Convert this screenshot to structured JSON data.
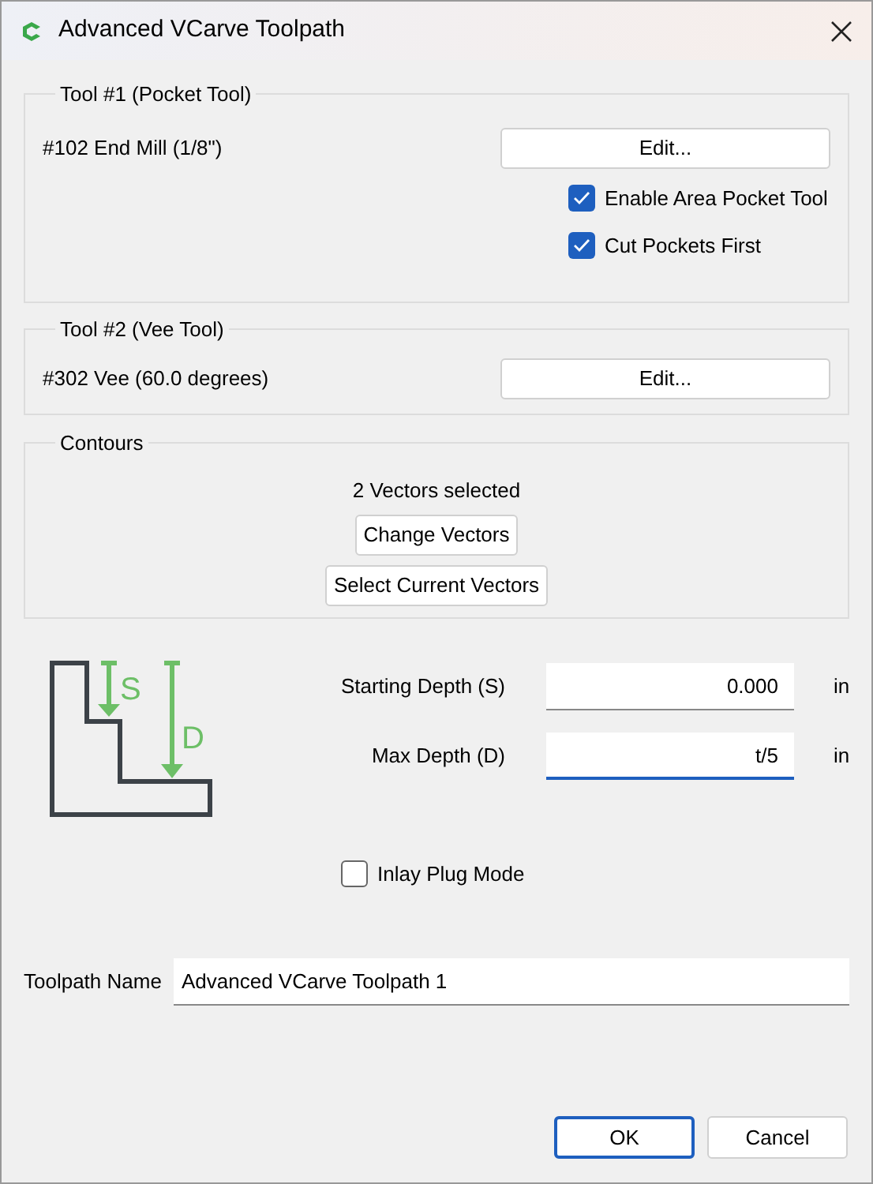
{
  "window": {
    "title": "Advanced VCarve Toolpath"
  },
  "tool1": {
    "title": "Tool #1 (Pocket Tool)",
    "tool_name": "#102 End Mill (1/8\")",
    "edit_button": "Edit...",
    "options": [
      {
        "label": "Enable Area Pocket Tool",
        "checked": true
      },
      {
        "label": "Cut Pockets First",
        "checked": true
      }
    ]
  },
  "tool2": {
    "title": "Tool #2 (Vee Tool)",
    "tool_name": "#302 Vee (60.0 degrees)",
    "edit_button": "Edit..."
  },
  "contours": {
    "title": "Contours",
    "status": "2 Vectors selected",
    "buttons": [
      "Change Vectors",
      "Select Current Vectors"
    ]
  },
  "depth": {
    "diagram_labels": [
      "S",
      "D"
    ],
    "fields": [
      {
        "label": "Starting Depth (S)",
        "value": "0.000",
        "unit": "in",
        "focused": false
      },
      {
        "label": "Max Depth (D)",
        "value": "t/5",
        "unit": "in",
        "focused": true
      }
    ],
    "inlay": {
      "label": "Inlay Plug Mode",
      "checked": false
    }
  },
  "toolpath_name": {
    "label": "Toolpath Name",
    "value": "Advanced VCarve Toolpath 1"
  },
  "buttons": [
    {
      "label": "OK",
      "default": true
    },
    {
      "label": "Cancel",
      "default": false
    }
  ]
}
